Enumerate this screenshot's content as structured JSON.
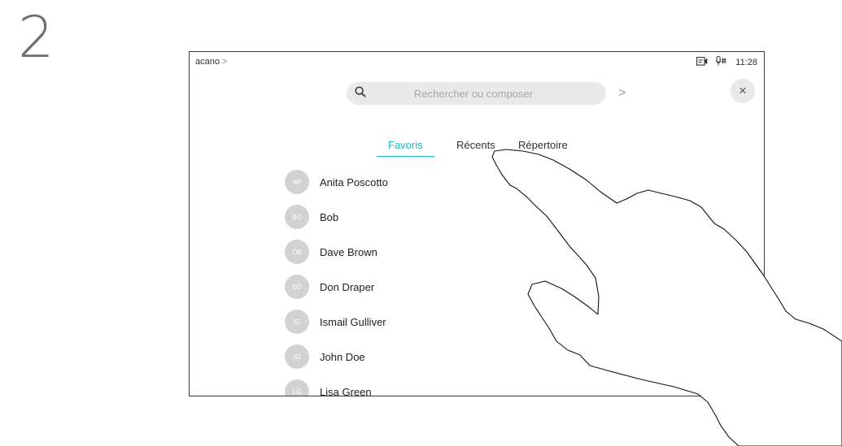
{
  "step": {
    "number": "2"
  },
  "header": {
    "device_label": "acano",
    "chevron": ">",
    "time": "11:28",
    "icons": [
      "camera-icon",
      "mic-icon"
    ]
  },
  "search": {
    "placeholder": "Rechercher ou composer",
    "go_chevron": ">"
  },
  "close": {
    "glyph": "×"
  },
  "tabs": [
    {
      "label": "Favoris",
      "active": true
    },
    {
      "label": "Récents",
      "active": false
    },
    {
      "label": "Répertoire",
      "active": false
    }
  ],
  "contacts": [
    {
      "initials": "AP",
      "name": "Anita Poscotto"
    },
    {
      "initials": "BO",
      "name": "Bob"
    },
    {
      "initials": "DB",
      "name": "Dave Brown"
    },
    {
      "initials": "DD",
      "name": "Don Draper"
    },
    {
      "initials": "IG",
      "name": "Ismail Gulliver"
    },
    {
      "initials": "JD",
      "name": "John Doe"
    },
    {
      "initials": "LG",
      "name": "Lisa Green"
    }
  ],
  "colors": {
    "accent": "#1fb6c4",
    "avatar": "#d2d2d2",
    "frame": "#3a3a3a"
  }
}
